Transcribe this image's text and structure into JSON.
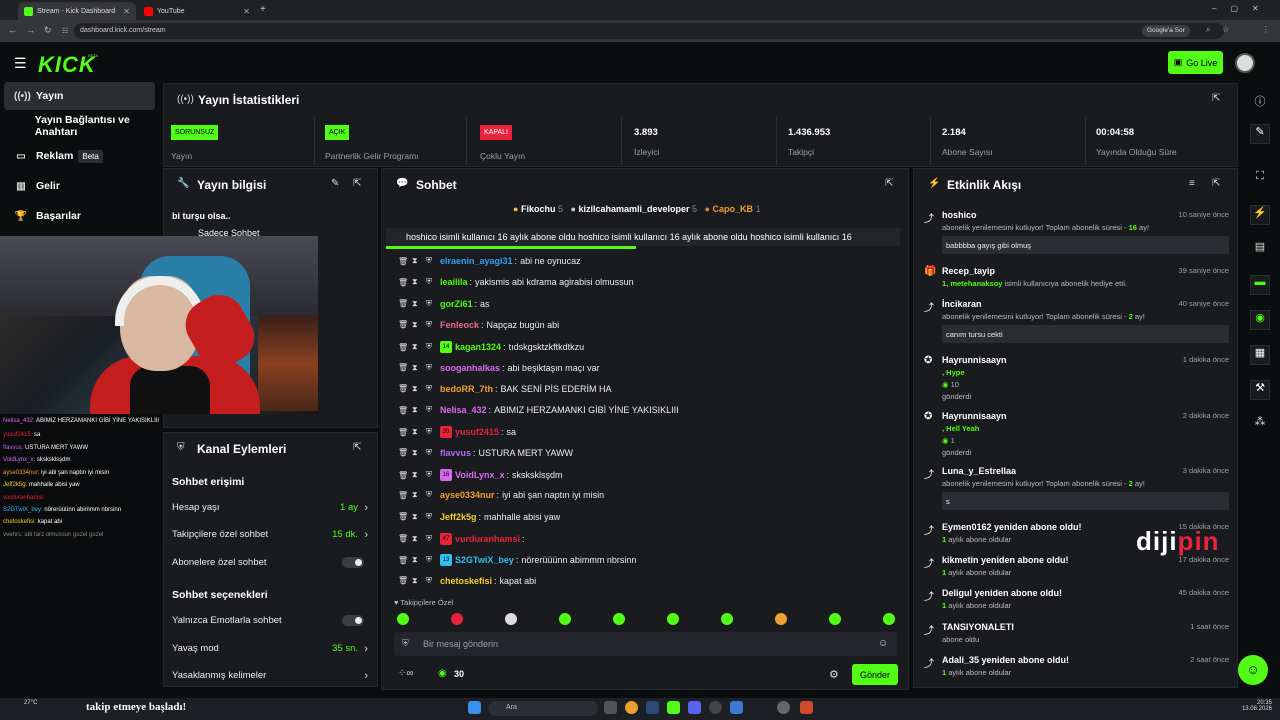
{
  "browser": {
    "tab1": "Stream - Kick Dashboard",
    "tab2": "YouTube",
    "url": "dashboard.kick.com/stream",
    "google": "Google'a Sor"
  },
  "header": {
    "logo": "KICK",
    "logo_beta": "BETA",
    "go_live": "Go Live"
  },
  "sidebar": {
    "items": [
      {
        "label": "Yayın",
        "icon": "broadcast-icon"
      },
      {
        "label": "Yayın Bağlantısı ve Anahtarı",
        "icon": "key-icon"
      },
      {
        "label": "Reklam",
        "icon": "ad-icon",
        "badge": "Beta"
      },
      {
        "label": "Gelir",
        "icon": "chart-icon"
      },
      {
        "label": "Başarılar",
        "icon": "trophy-icon"
      }
    ]
  },
  "stats": {
    "title": "Yayın İstatistikleri",
    "items": [
      {
        "badge": "SORUNSUZ",
        "badge_color": "#53fc18",
        "label": "Yayın"
      },
      {
        "badge": "AÇIK",
        "badge_color": "#53fc18",
        "label": "Partnerlik Gelir Programı"
      },
      {
        "badge": "KAPALI",
        "badge_color": "#e8233c",
        "label": "Çoklu Yayın"
      },
      {
        "value": "3.893",
        "label": "İzleyici"
      },
      {
        "value": "1.436.953",
        "label": "Takipçi"
      },
      {
        "value": "2.184",
        "label": "Abone Sayısı"
      },
      {
        "value": "00:04:58",
        "label": "Yayında Olduğu Süre"
      }
    ]
  },
  "info": {
    "title": "Yayın bilgisi",
    "text": "bi turşu olsa..",
    "sub": "Sadece Sohbet"
  },
  "cam_chat": [
    {
      "user": "Nelisa_432:",
      "msg": "ABIMIZ HERZAMANKI GİBİ YİNE YAKISIKLIII",
      "color": "#d86af0"
    },
    {
      "user": "yusuf2415:",
      "msg": "sa",
      "color": "#e8233c"
    },
    {
      "user": "flavvus:",
      "msg": "USTURA MERT YAWW",
      "color": "#b06af0"
    },
    {
      "user": "VoidLynx_x:",
      "msg": "sksksklsşdm",
      "color": "#d86af0"
    },
    {
      "user": "ayse0334nur:",
      "msg": "iyi abi şan naptın iyi misin",
      "color": "#f0a030"
    },
    {
      "user": "Jeff2k5g:",
      "msg": "mahhalle abisi yaw",
      "color": "#f0d030"
    },
    {
      "user": "vurduranhamsi:",
      "msg": "",
      "color": "#e8233c"
    },
    {
      "user": "S2GTwiX_bey:",
      "msg": "nörerüüünn abimmm nbrsinn",
      "color": "#30c0f0"
    },
    {
      "user": "chetoskefisi:",
      "msg": "kapat abi",
      "color": "#f0d030"
    },
    {
      "user": "veehrs:",
      "msg": "abi tarz olmussun guzel guzel",
      "color": "#888"
    }
  ],
  "follow_banner": "takip etmeye başladı!",
  "kanal": {
    "title": "Kanal Eylemleri",
    "sec1": "Sohbet erişimi",
    "rows1": [
      {
        "label": "Hesap yaşı",
        "value": "1 ay"
      },
      {
        "label": "Takipçilere özel sohbet",
        "value": "15 dk."
      },
      {
        "label": "Abonelere özel sohbet",
        "value": ""
      }
    ],
    "sec2": "Sohbet seçenekleri",
    "rows2": [
      {
        "label": "Yalnızca Emotlarla sohbet",
        "value": ""
      },
      {
        "label": "Yavaş mod",
        "value": "35 sn."
      },
      {
        "label": "Yasaklanmış kelimeler",
        "value": ""
      }
    ]
  },
  "chat": {
    "title": "Sohbet",
    "top": [
      {
        "name": "Fikochu",
        "n": "5"
      },
      {
        "name": "kizilcahamamli_developer",
        "n": "5"
      },
      {
        "name": "Capo_KB",
        "n": "1"
      }
    ],
    "ticker": "hoshico isimli kullanıcı 16 aylık abone oldu   hoshico isimli kullanıcı 16 aylık abone oldu   hoshico isimli kullanıcı 16",
    "messages": [
      {
        "user": "elraenin_ayagi31",
        "msg": "abi ne oynucaz",
        "color": "#30a0f0"
      },
      {
        "user": "leailila",
        "msg": "yakismis abi kdrama agirabisi olmussun",
        "color": "#53fc18"
      },
      {
        "user": "gorZi61",
        "msg": "as",
        "color": "#53fc18"
      },
      {
        "user": "Fenleock",
        "msg": "Napçaz bugün abi",
        "color": "#f06a8a"
      },
      {
        "user": "kagan1324",
        "msg": "tıdskgsktzkftkdtkzu",
        "color": "#53fc18",
        "badge": "14"
      },
      {
        "user": "sooganhalkas",
        "msg": "abi beşiktaşın maçı var",
        "color": "#d86af0"
      },
      {
        "user": "bedoRR_7th",
        "msg": "BAK SENİ PİS EDERİM HA",
        "color": "#f0a030"
      },
      {
        "user": "Nelisa_432",
        "msg": "ABIMIZ HERZAMANKI GİBİ YİNE YAKISIKLIII",
        "color": "#d86af0"
      },
      {
        "user": "yusuf2415",
        "msg": "sa",
        "color": "#e8233c",
        "badge": "20"
      },
      {
        "user": "flavvus",
        "msg": "USTURA MERT YAWW",
        "color": "#b06af0"
      },
      {
        "user": "VoidLynx_x",
        "msg": "sksksklsşdm",
        "color": "#d86af0",
        "badge": "16"
      },
      {
        "user": "ayse0334nur",
        "msg": "iyi abi şan naptın iyi misin",
        "color": "#f0a030"
      },
      {
        "user": "Jeff2k5g",
        "msg": "mahhalle abisi yaw",
        "color": "#f0d030"
      },
      {
        "user": "vurduranhamsi",
        "msg": "",
        "color": "#e8233c",
        "badge": "47"
      },
      {
        "user": "S2GTwiX_bey",
        "msg": "nörerüüünn abimmm nbrsinn",
        "color": "#30c0f0",
        "badge": "13"
      },
      {
        "user": "chetoskefisi",
        "msg": "kapat abi",
        "color": "#f0d030"
      }
    ],
    "emote_label": "Takipçilere Özel",
    "placeholder": "Bir mesaj gönderin",
    "points": "30",
    "send": "Gönder"
  },
  "activity": {
    "title": "Etkinlik Akışı",
    "events": [
      {
        "user": "hoshico",
        "time": "10 saniye önce",
        "sub": "abonelik yenilemesini kutluyor! Toplam abonelik süresi - ",
        "hl": "16",
        "sub2": " ay!",
        "note": "babbbba gayış gibi olmuş"
      },
      {
        "user": "Recep_tayip",
        "time": "39 saniye önce",
        "hl": "1, metehanaksoy",
        "sub2": " isimli kullanıcıya abonelik hediye etti."
      },
      {
        "user": "İncikaran",
        "time": "40 saniye önce",
        "sub": "abonelik yenilemesini kutluyor! Toplam abonelik süresi - ",
        "hl": "2",
        "sub2": " ay!",
        "note": "canım tursu cekti"
      },
      {
        "user": "Hayrunnisaayn",
        "time": "1 dakika önce",
        "hl": ", Hype",
        "amount": "10",
        "sent": "gönderdi"
      },
      {
        "user": "Hayrunnisaayn",
        "time": "2 dakika önce",
        "hl": ", Hell Yeah",
        "amount": "1",
        "sent": "gönderdi"
      },
      {
        "user": "Luna_y_Estrellaa",
        "time": "3 dakika önce",
        "sub": "abonelik yenilemesini kutluyor! Toplam abonelik süresi - ",
        "hl": "2",
        "sub2": " ay!",
        "note": "s"
      },
      {
        "user": "Eymen0162 yeniden abone oldu!",
        "time": "15 dakika önce",
        "hl": "1",
        "sub2": " aylık abone oldular"
      },
      {
        "user": "kikmetin yeniden abone oldu!",
        "time": "17 dakika önce",
        "hl": "1",
        "sub2": " aylık abone oldular"
      },
      {
        "user": "Deligul yeniden abone oldu!",
        "time": "45 dakika önce",
        "hl": "1",
        "sub2": " aylık abone oldular"
      },
      {
        "user": "TANSIYONALETI",
        "time": "1 saat önce",
        "sub": "abone oldu"
      },
      {
        "user": "Adali_35 yeniden abone oldu!",
        "time": "2 saat önce",
        "hl": "1",
        "sub2": " aylık abone oldular"
      }
    ]
  },
  "taskbar": {
    "search": "Ara",
    "weather": "27°C",
    "time": "20:35",
    "date": "13.08.2026"
  },
  "watermark": {
    "a": "diji",
    "b": "pin"
  },
  "colors": {
    "accent": "#53fc18",
    "bg": "#0b0e0f",
    "panel": "#191b1f",
    "danger": "#e8233c"
  }
}
